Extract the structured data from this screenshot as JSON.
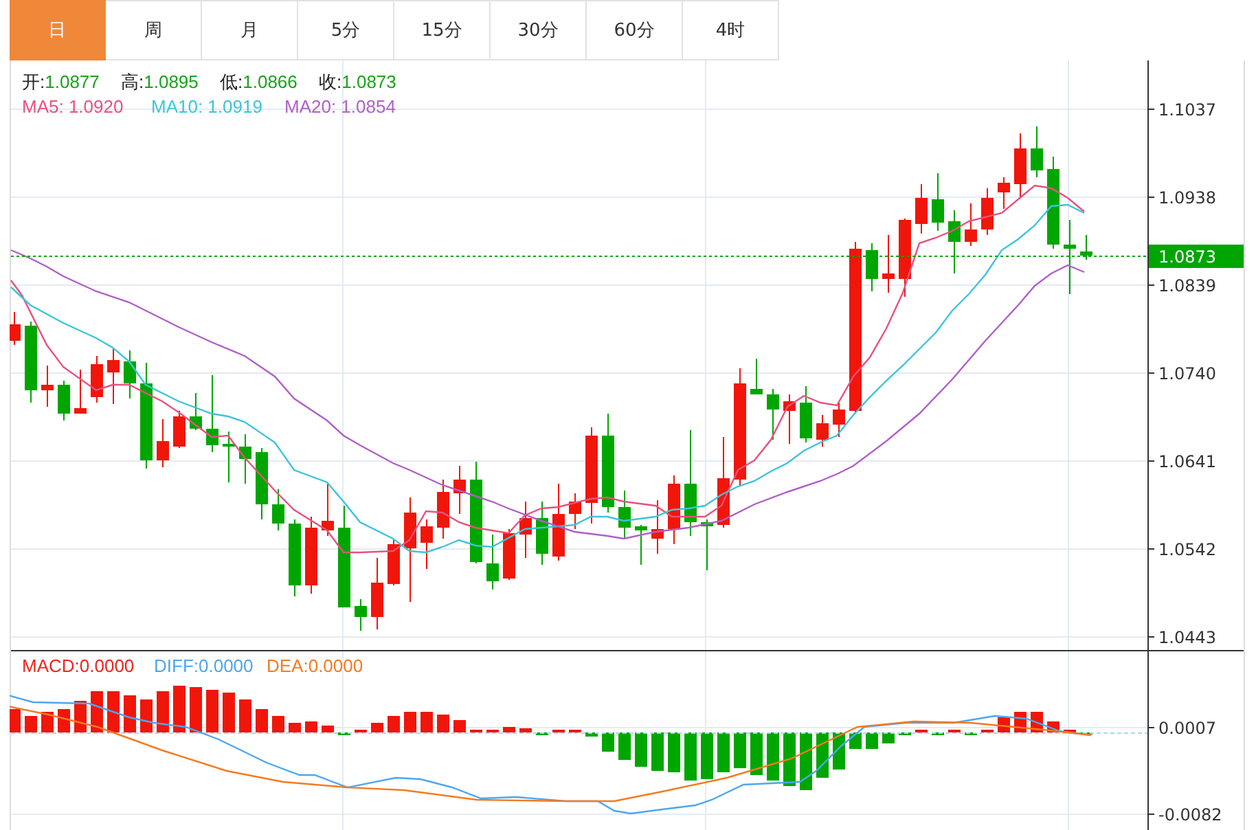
{
  "tabs": [
    {
      "label": "日",
      "selected": true
    },
    {
      "label": "周",
      "selected": false
    },
    {
      "label": "月",
      "selected": false
    },
    {
      "label": "5分",
      "selected": false
    },
    {
      "label": "15分",
      "selected": false
    },
    {
      "label": "30分",
      "selected": false
    },
    {
      "label": "60分",
      "selected": false
    },
    {
      "label": "4时",
      "selected": false
    }
  ],
  "ohlc_legend": [
    {
      "label": "开:",
      "value": "1.0877"
    },
    {
      "label": "高:",
      "value": "1.0895"
    },
    {
      "label": "低:",
      "value": "1.0866"
    },
    {
      "label": "收:",
      "value": "1.0873"
    }
  ],
  "ma_legend": [
    {
      "label": "MA5:",
      "value": "1.0920",
      "color": "#e8517f"
    },
    {
      "label": "MA10:",
      "value": "1.0919",
      "color": "#3cc4dc"
    },
    {
      "label": "MA20:",
      "value": "1.0854",
      "color": "#b05fc8"
    }
  ],
  "price_axis": {
    "ticks": [
      "1.1037",
      "1.0938",
      "1.0839",
      "1.0740",
      "1.0641",
      "1.0542",
      "1.0443"
    ],
    "last_price": "1.0873"
  },
  "macd_legend": [
    {
      "label": "MACD:",
      "value": "0.0000",
      "color": "#f0241a"
    },
    {
      "label": "DIFF:",
      "value": "0.0000",
      "color": "#4da6ef"
    },
    {
      "label": "DEA:",
      "value": "0.0000",
      "color": "#f57a20"
    }
  ],
  "macd_axis": {
    "ticks": [
      "0.0007",
      "-0.0082"
    ]
  }
}
